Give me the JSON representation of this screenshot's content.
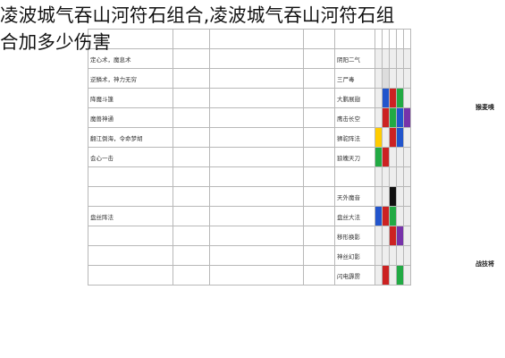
{
  "title": {
    "line1": "凌波城气吞山河符石组合,凌波城气吞山河符石组",
    "line2": "合加多少伤害"
  },
  "side_labels": [
    "猴麦嗅",
    "战技将"
  ],
  "rows": [
    {
      "a": "",
      "b": "",
      "c": "",
      "d": "",
      "e": "",
      "colors": [
        "#ffffff",
        "#ffffff",
        "#ffffff",
        "#ffffff",
        "#ffffff"
      ]
    },
    {
      "a": "定心术，魔息术",
      "b": "",
      "c": "",
      "d": "",
      "e": "阴阳二气",
      "colors": [
        "#eeeeee",
        "#eeeeee",
        "#eeeeee",
        "#eeeeee",
        "#eeeeee"
      ]
    },
    {
      "a": "逆鳞术，神力无穷",
      "b": "",
      "c": "",
      "d": "",
      "e": "三尸毒",
      "colors": [
        "#eeeeee",
        "#dddddd",
        "#eeeeee",
        "#eeeeee",
        "#eeeeee"
      ]
    },
    {
      "a": "降魔斗篷",
      "b": "",
      "c": "",
      "d": "",
      "e": "大鹏展翅",
      "colors": [
        "#eeeeee",
        "#2255cc",
        "#cc2222",
        "#22aa44",
        "#eeeeee"
      ]
    },
    {
      "a": "魔兽神通",
      "b": "",
      "c": "",
      "d": "",
      "e": "鹰击长空",
      "colors": [
        "#eeeeee",
        "#cc2222",
        "#22aa44",
        "#2255cc",
        "#7733aa"
      ]
    },
    {
      "a": "翻江倒海，令命梦胡",
      "b": "",
      "c": "",
      "d": "",
      "e": "狮驼阵法",
      "colors": [
        "#ffcc00",
        "#eeeeee",
        "#cc2222",
        "#2255cc",
        "#eeeeee"
      ]
    },
    {
      "a": "会心一击",
      "b": "",
      "c": "",
      "d": "",
      "e": "狼魄天刀",
      "colors": [
        "#22aa44",
        "#cc2222",
        "#eeeeee",
        "#eeeeee",
        "#eeeeee"
      ]
    },
    {
      "a": "",
      "b": "",
      "c": "",
      "d": "",
      "e": "",
      "colors": [
        "#eeeeee",
        "#eeeeee",
        "#eeeeee",
        "#eeeeee",
        "#eeeeee"
      ]
    },
    {
      "a": "",
      "b": "",
      "c": "",
      "d": "",
      "e": "天外魔音",
      "colors": [
        "#eeeeee",
        "#eeeeee",
        "#111111",
        "#eeeeee",
        "#eeeeee"
      ]
    },
    {
      "a": "盘丝阵法",
      "b": "",
      "c": "",
      "d": "",
      "e": "盘丝大法",
      "colors": [
        "#2255cc",
        "#cc2222",
        "#22aa44",
        "#eeeeee",
        "#eeeeee"
      ]
    },
    {
      "a": "",
      "b": "",
      "c": "",
      "d": "",
      "e": "移形换影",
      "colors": [
        "#eeeeee",
        "#eeeeee",
        "#cc2222",
        "#7733aa",
        "#eeeeee"
      ]
    },
    {
      "a": "",
      "b": "",
      "c": "",
      "d": "",
      "e": "神丝幻影",
      "colors": [
        "#eeeeee",
        "#eeeeee",
        "#eeeeee",
        "#eeeeee",
        "#eeeeee"
      ]
    },
    {
      "a": "",
      "b": "",
      "c": "",
      "d": "",
      "e": "闪电霹雳",
      "colors": [
        "#eeeeee",
        "#cc2222",
        "#eeeeee",
        "#22aa44",
        "#eeeeee"
      ]
    }
  ]
}
